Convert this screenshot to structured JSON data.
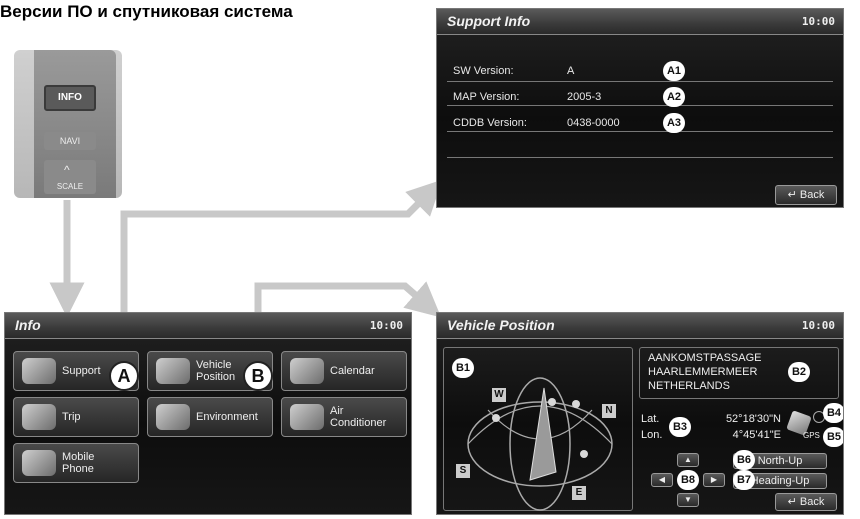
{
  "heading": "Версии ПО и спутниковая система",
  "remote": {
    "info_label": "INFO",
    "navi_label": "NAVI",
    "scale_label": "SCALE"
  },
  "support_screen": {
    "title": "Support Info",
    "time": "10:00",
    "rows": [
      {
        "label": "SW Version:",
        "value": "A",
        "badge": "A1"
      },
      {
        "label": "MAP Version:",
        "value": "2005-3",
        "badge": "A2"
      },
      {
        "label": "CDDB Version:",
        "value": "0438-0000",
        "badge": "A3"
      }
    ],
    "back_label": "Back"
  },
  "info_screen": {
    "title": "Info",
    "time": "10:00",
    "buttons": [
      {
        "label": "Support",
        "icon": "support-icon"
      },
      {
        "label": "Vehicle\nPosition",
        "icon": "satellite-icon"
      },
      {
        "label": "Calendar",
        "icon": "calendar-icon"
      },
      {
        "label": "Trip",
        "icon": "car-icon"
      },
      {
        "label": "Environment",
        "icon": "tree-icon"
      },
      {
        "label": "Air\nConditioner",
        "icon": "fan-icon"
      },
      {
        "label": "Mobile\nPhone",
        "icon": "phone-icon"
      }
    ],
    "callout_a": "A",
    "callout_b": "B"
  },
  "vehicle_screen": {
    "title": "Vehicle Position",
    "time": "10:00",
    "address": [
      "AANKOMSTPASSAGE",
      "HAARLEMMERMEER",
      "NETHERLANDS"
    ],
    "lat_label": "Lat.",
    "lon_label": "Lon.",
    "lat_value": "52°18'30\"N",
    "lon_value": "4°45'41\"E",
    "gps_label": "GPS",
    "compass": {
      "w": "W",
      "n": "N",
      "s": "S",
      "e": "E"
    },
    "north_up": "North-Up",
    "heading_up": "Heading-Up",
    "back_label": "Back",
    "badges": {
      "b1": "B1",
      "b2": "B2",
      "b3": "B3",
      "b4": "B4",
      "b5": "B5",
      "b6": "B6",
      "b7": "B7",
      "b8": "B8"
    }
  },
  "colors": {
    "arrow": "#c8c8c8",
    "panel": "#121212",
    "badge": "#ffffff"
  }
}
